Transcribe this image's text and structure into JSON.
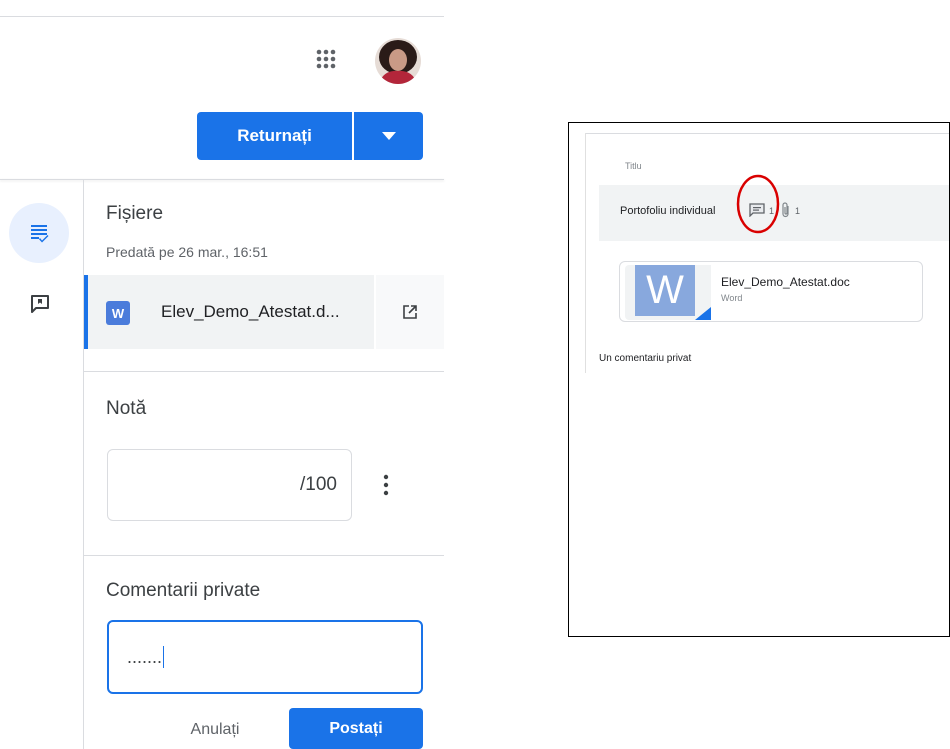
{
  "header": {
    "apps_icon": "apps-grid-icon",
    "avatar_icon": "user-avatar"
  },
  "actions": {
    "return_label": "Returnați",
    "return_dropdown_icon": "caret-down-icon"
  },
  "rail": {
    "items": [
      {
        "name": "student-work",
        "icon": "assignment-list-icon",
        "active": true
      },
      {
        "name": "private-comments",
        "icon": "comment-icon",
        "active": false
      }
    ]
  },
  "files": {
    "title": "Fișiere",
    "submitted": "Predată pe 26 mar., 16:51",
    "items": [
      {
        "type_letter": "W",
        "name": "Elev_Demo_Atestat.d...",
        "open_icon": "open-in-new-icon"
      }
    ]
  },
  "grade": {
    "title": "Notă",
    "value": "",
    "out_of": "/100",
    "more_icon": "more-vert-icon"
  },
  "private_comments": {
    "title": "Comentarii private",
    "input_value": ".......",
    "cancel_label": "Anulați",
    "post_label": "Postați"
  },
  "inset": {
    "column_label": "Titlu",
    "assignment_title": "Portofoliu individual",
    "comment_count": "1",
    "attachment_count": "1",
    "file": {
      "letter": "W",
      "name": "Elev_Demo_Atestat.doc",
      "type": "Word"
    },
    "private_comment": "Un comentariu privat"
  },
  "colors": {
    "primary": "#1a73e8",
    "highlight_circle": "#d90000",
    "divider": "#dadce0"
  }
}
